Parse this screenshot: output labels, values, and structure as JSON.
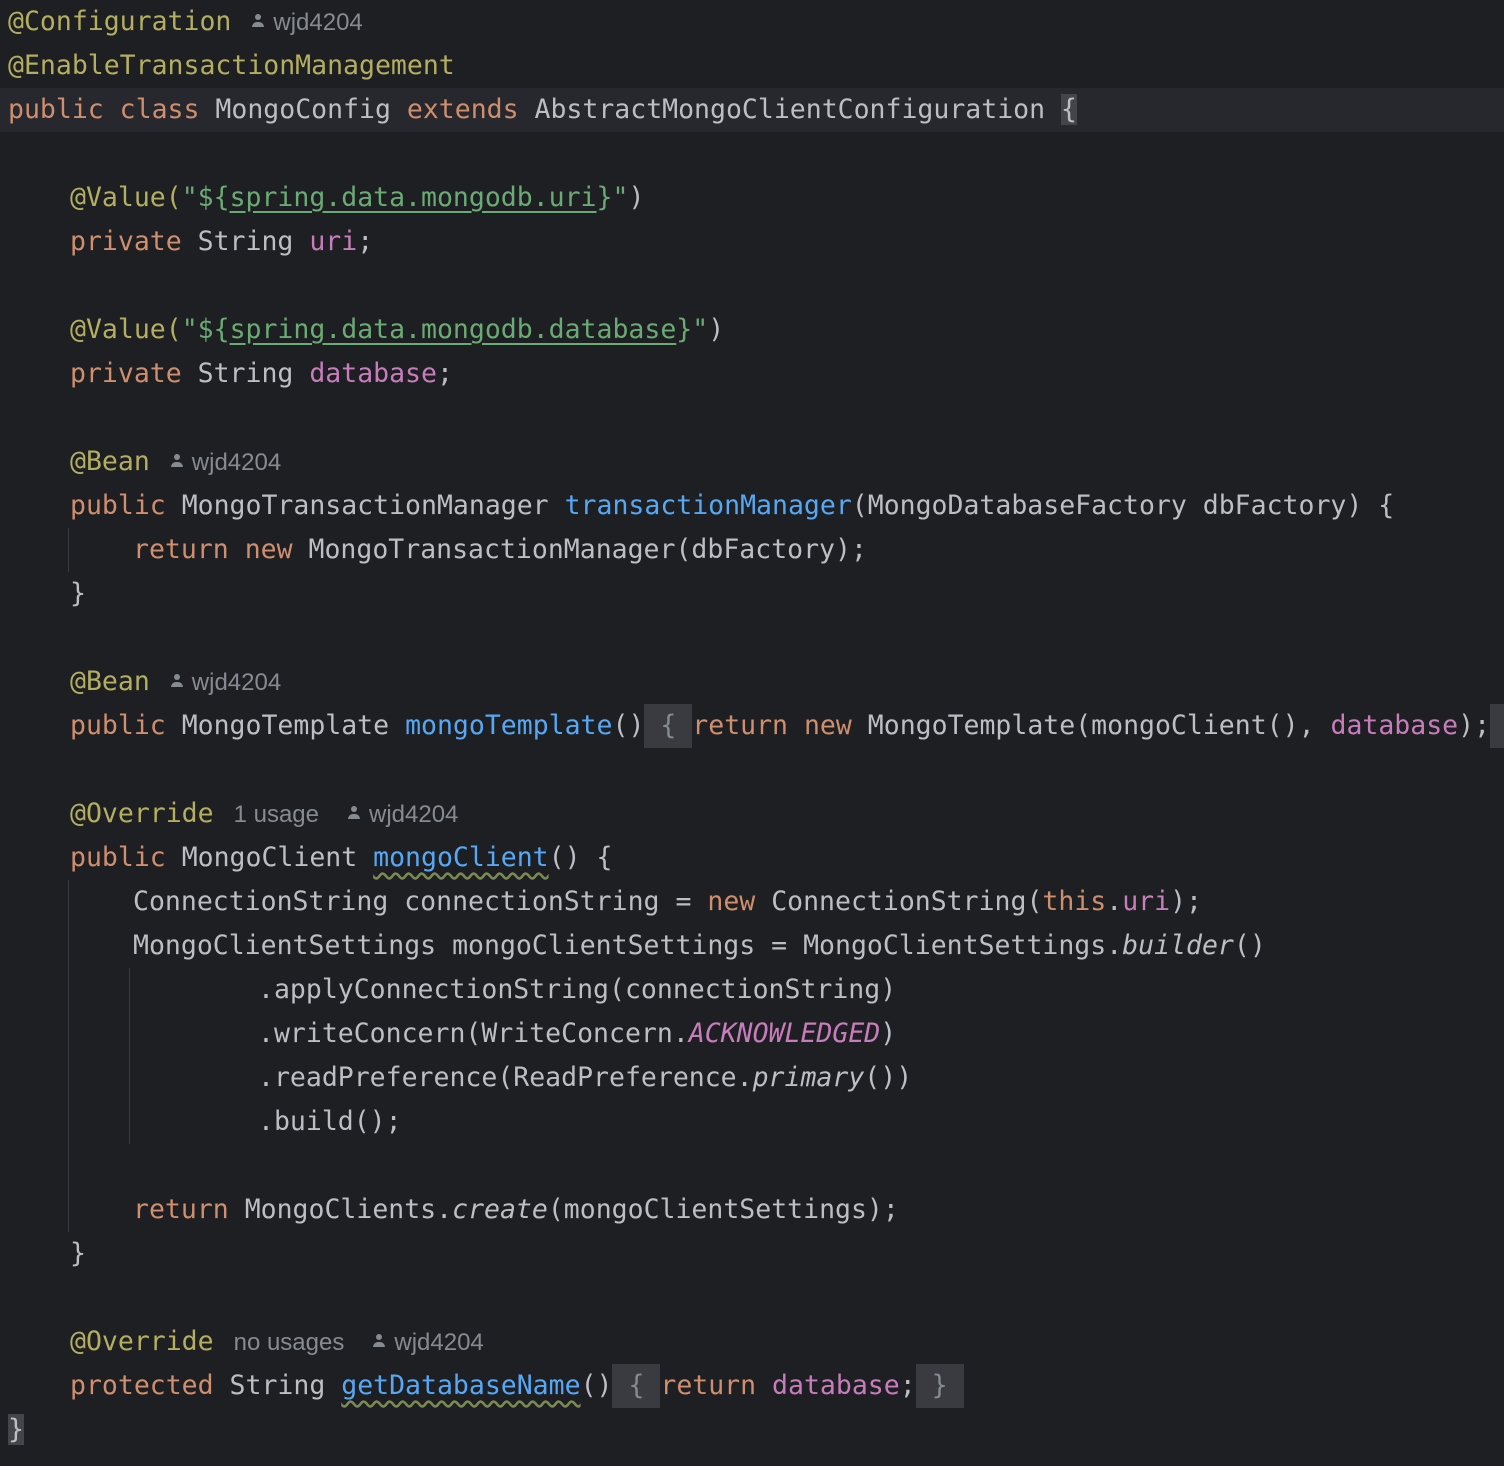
{
  "editor": {
    "author": "wjd4204",
    "usage_one": "1 usage",
    "usage_none": "no usages",
    "lines": {
      "l1_ann": "@Configuration",
      "l2_ann": "@EnableTransactionManagement",
      "l3_kw": "public class ",
      "l3_name": "MongoConfig ",
      "l3_ext": "extends ",
      "l3_super": "AbstractMongoClientConfiguration ",
      "l3_brace": "{",
      "value_ann": "@Value(",
      "q_open": "\"${",
      "uri_key": "spring.data.mongodb.uri",
      "q_close": "}\"",
      "paren_close": ")",
      "private_kw": "private ",
      "string_type": "String ",
      "uri_field": "uri",
      "semi": ";",
      "db_key": "spring.data.mongodb.database",
      "db_field": "database",
      "bean_ann": "@Bean",
      "public_kw": "public ",
      "tm_type": "MongoTransactionManager ",
      "tm_fn": "transactionManager",
      "tm_params": "(MongoDatabaseFactory dbFactory) {",
      "return_kw": "return ",
      "new_kw": "new ",
      "tm_new": "MongoTransactionManager(dbFactory);",
      "close_brace": "}",
      "mt_type": "MongoTemplate ",
      "mt_fn": "mongoTemplate",
      "mt_parens": "()",
      "fold_open": " { ",
      "mt_new": "MongoTemplate(mongoClient(), ",
      "mt_end": ");",
      "fold_close": " } ",
      "override_ann": "@Override",
      "mc_type": "MongoClient ",
      "mc_fn": "mongoClient",
      "mc_parens": "() {",
      "cs_decl": "ConnectionString connectionString = ",
      "cs_new": "ConnectionString(",
      "this_kw": "this",
      "dot": ".",
      "cs_end": ");",
      "mcs_decl": "MongoClientSettings mongoClientSettings = MongoClientSettings.",
      "builder": "builder",
      "empty_parens": "()",
      "apply": ".applyConnectionString(connectionString)",
      "write_a": ".writeConcern(WriteConcern.",
      "ack": "ACKNOWLEDGED",
      "read_a": ".readPreference(ReadPreference.",
      "primary": "primary",
      "read_end": "())",
      "build": ".build();",
      "mcs_return": "MongoClients.",
      "create": "create",
      "create_args": "(mongoClientSettings);",
      "protected_kw": "protected ",
      "gdn_fn": "getDatabaseName",
      "final_brace": "}"
    }
  },
  "colors": {
    "background": "#1e1f22",
    "keyword": "#cf8e6d",
    "annotation": "#b3ae60",
    "string": "#6aab73",
    "field": "#c77dbb",
    "function": "#56a8f5",
    "text": "#bcbec4",
    "hint": "#868a91"
  }
}
